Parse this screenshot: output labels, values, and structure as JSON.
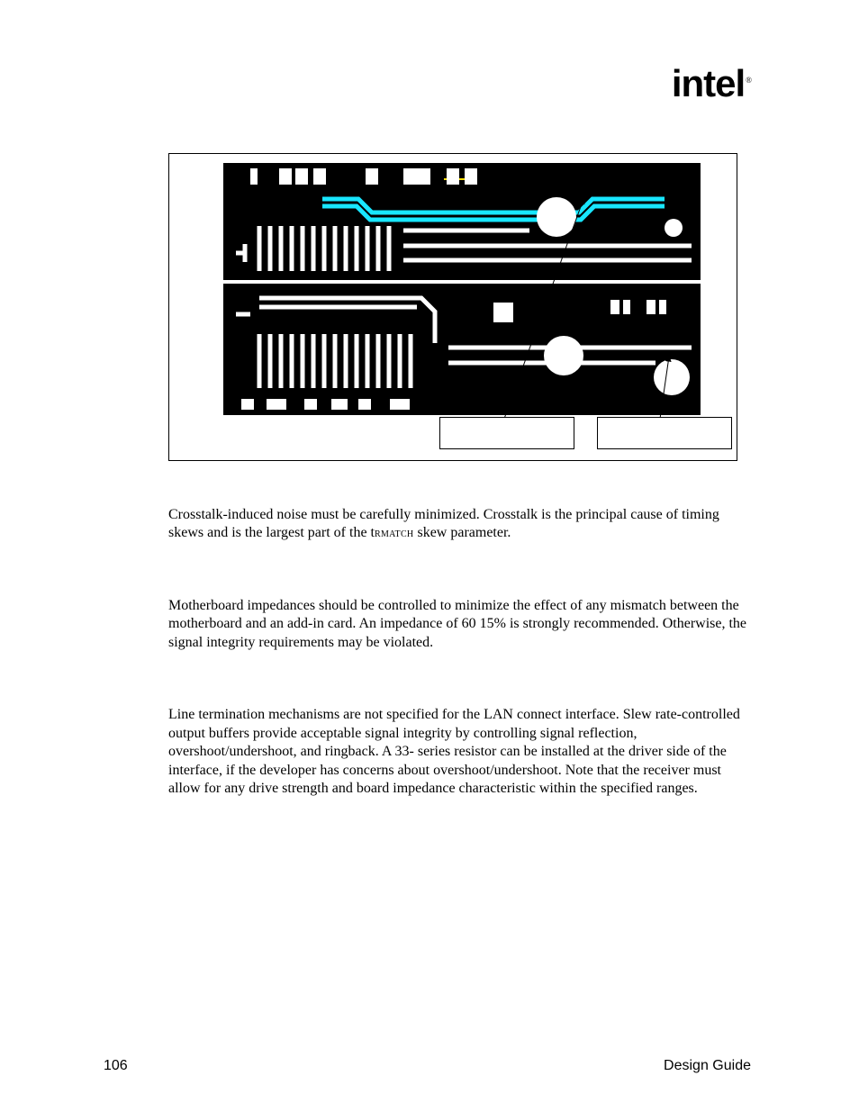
{
  "brand": {
    "name": "intel",
    "mark": "®"
  },
  "paragraphs": {
    "crosstalk_a": "Crosstalk-induced noise must be carefully minimized. Crosstalk is the principal cause of timing skews and is the largest part of the t",
    "crosstalk_sub": "RMATCH",
    "crosstalk_b": " skew parameter.",
    "impedance": "Motherboard impedances should be controlled to minimize the effect of any mismatch between the motherboard and an add-in card. An impedance of 60      15% is strongly recommended. Otherwise, the signal integrity requirements may be violated.",
    "termination": "Line termination mechanisms are not specified for the LAN connect interface. Slew rate-controlled output buffers provide acceptable signal integrity by controlling signal reflection, overshoot/undershoot, and ringback. A 33-   series resistor can be installed at the driver side of the interface, if the developer has concerns about overshoot/undershoot. Note that the receiver must allow for any drive strength and board impedance characteristic within the specified ranges."
  },
  "footer": {
    "page": "106",
    "title": "Design Guide"
  }
}
